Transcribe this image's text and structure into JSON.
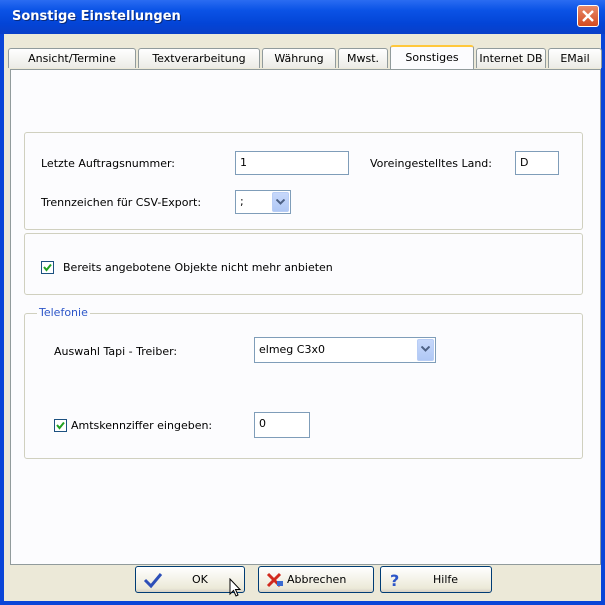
{
  "window": {
    "title": "Sonstige Einstellungen"
  },
  "tabs": [
    {
      "label": "Ansicht/Termine"
    },
    {
      "label": "Textverarbeitung"
    },
    {
      "label": "Währung"
    },
    {
      "label": "Mwst."
    },
    {
      "label": "Sonstiges",
      "active": true
    },
    {
      "label": "Internet DB"
    },
    {
      "label": "EMail"
    }
  ],
  "general": {
    "last_order_label": "Letzte Auftragsnummer:",
    "last_order_value": "1",
    "default_country_label": "Voreingestelltes Land:",
    "default_country_value": "D",
    "csv_separator_label": "Trennzeichen für CSV-Export:",
    "csv_separator_value": ";"
  },
  "objects": {
    "checkbox_label": "Bereits angebotene Objekte nicht mehr anbieten",
    "checked": true
  },
  "telefonie": {
    "legend": "Telefonie",
    "tapi_label": "Auswahl Tapi - Treiber:",
    "tapi_value": "elmeg C3x0",
    "amt_label": "Amtskennziffer eingeben:",
    "amt_checked": true,
    "amt_value": "0"
  },
  "buttons": {
    "ok": "OK",
    "cancel": "Abbrechen",
    "help": "Hilfe"
  }
}
